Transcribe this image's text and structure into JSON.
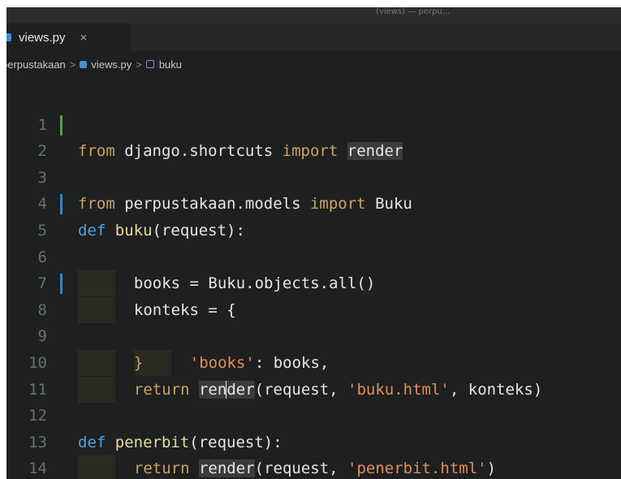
{
  "titlebar": {
    "text": "(views) — perpu..."
  },
  "tab": {
    "label": "views.py",
    "close": "×"
  },
  "breadcrumb": {
    "folder": "perpustakaan",
    "file": "views.py",
    "symbol": "buku",
    "sep": ">"
  },
  "colors": {
    "background": "#1e1f1f",
    "keyword": "#c9a463",
    "def": "#4ea3dd",
    "string": "#e28d5c",
    "text": "#e6e6e6",
    "gutter_added": "#5a9e4b",
    "gutter_modified": "#2e88c8"
  },
  "lines": [
    {
      "n": "1",
      "p": [
        "from",
        " django.shortcuts ",
        "import",
        " ",
        "render"
      ]
    },
    {
      "n": "2",
      "p": [
        "from",
        " perpustakaan.models ",
        "import",
        " Buku"
      ]
    },
    {
      "n": "3",
      "p": []
    },
    {
      "n": "4",
      "p": [
        "def",
        " ",
        "buku",
        "(request):"
      ]
    },
    {
      "n": "5",
      "p": [
        "books = Buku.objects.all()"
      ]
    },
    {
      "n": "6",
      "p": []
    },
    {
      "n": "7",
      "p": [
        "konteks = {"
      ]
    },
    {
      "n": "8",
      "p": [
        "'books'",
        ": books,"
      ]
    },
    {
      "n": "9",
      "p": [
        "}"
      ]
    },
    {
      "n": "10",
      "p": [
        "return",
        " ",
        "ren",
        "der",
        "(request, ",
        "'buku.html'",
        ", konteks)"
      ]
    },
    {
      "n": "11",
      "p": []
    },
    {
      "n": "12",
      "p": [
        "def",
        " ",
        "penerbit",
        "(request):"
      ]
    },
    {
      "n": "13",
      "p": [
        "return",
        " ",
        "render",
        "(request, ",
        "'penerbit.html'",
        ")"
      ]
    },
    {
      "n": "14",
      "p": []
    }
  ]
}
